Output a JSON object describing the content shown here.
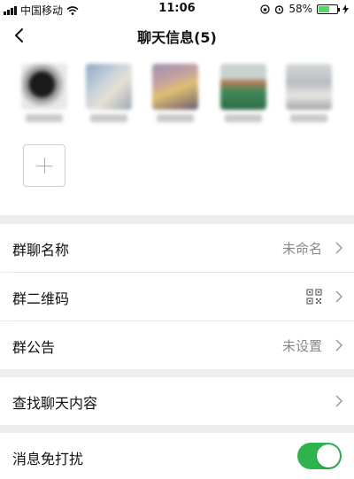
{
  "status_bar": {
    "carrier": "中国移动",
    "time": "11:06",
    "battery": "58%",
    "battery_level": 0.58
  },
  "nav": {
    "title": "聊天信息(5)",
    "back_icon": "chevron-left-icon"
  },
  "members": {
    "add_icon": "plus-icon"
  },
  "settings": {
    "group_name": {
      "label": "群聊名称",
      "value": "未命名"
    },
    "qr_code": {
      "label": "群二维码",
      "icon": "qr-code-icon"
    },
    "announcement": {
      "label": "群公告",
      "value": "未设置"
    },
    "search": {
      "label": "查找聊天内容"
    },
    "mute": {
      "label": "消息免打扰",
      "enabled": true
    }
  },
  "colors": {
    "toggle_on": "#2fb34f",
    "background": "#ededed",
    "secondary_text": "#888888"
  }
}
